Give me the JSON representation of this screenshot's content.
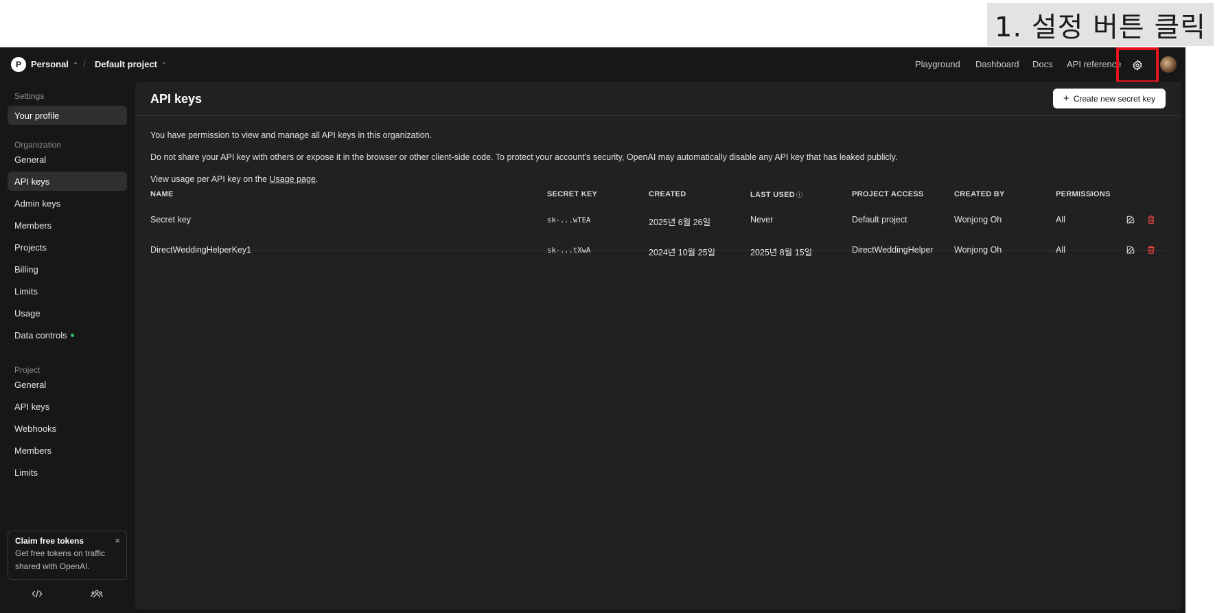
{
  "annotation": {
    "text": "1. 설정 버튼 클릭"
  },
  "topbar": {
    "org_initial": "P",
    "org_name": "Personal",
    "project_name": "Default project",
    "nav": [
      "Playground",
      "Dashboard",
      "Docs",
      "API reference"
    ]
  },
  "sidebar": {
    "settings_heading": "Settings",
    "your_profile": "Your profile",
    "organization_heading": "Organization",
    "org_items": [
      "General",
      "API keys",
      "Admin keys",
      "Members",
      "Projects",
      "Billing",
      "Limits",
      "Usage",
      "Data controls"
    ],
    "project_heading": "Project",
    "project_items": [
      "General",
      "API keys",
      "Webhooks",
      "Members",
      "Limits"
    ],
    "promo": {
      "title": "Claim free tokens",
      "body": "Get free tokens on traffic shared with OpenAI.",
      "close": "×"
    }
  },
  "main": {
    "title": "API keys",
    "create_button": "Create new secret key",
    "create_plus": "+",
    "info1": "You have permission to view and manage all API keys in this organization.",
    "info2": "Do not share your API key with others or expose it in the browser or other client-side code. To protect your account's security, OpenAI may automatically disable any API key that has leaked publicly.",
    "info3_prefix": "View usage per API key on the ",
    "info3_link": "Usage page",
    "info3_suffix": ".",
    "columns": [
      "NAME",
      "SECRET KEY",
      "CREATED",
      "LAST USED",
      "PROJECT ACCESS",
      "CREATED BY",
      "PERMISSIONS"
    ],
    "rows": [
      {
        "name": "Secret key",
        "secret": "sk-...wTEA",
        "created": "2025년 6월 26일",
        "last_used": "Never",
        "project": "Default project",
        "created_by": "Wonjong Oh",
        "permissions": "All"
      },
      {
        "name": "DirectWeddingHelperKey1",
        "secret": "sk-...tXwA",
        "created": "2024년 10월 25일",
        "last_used": "2025년 8월 15일",
        "project": "DirectWeddingHelper",
        "created_by": "Wonjong Oh",
        "permissions": "All"
      }
    ]
  },
  "colors": {
    "accent_red": "#e3141c",
    "delete_red": "#ef4444",
    "status_green": "#22c55e"
  }
}
